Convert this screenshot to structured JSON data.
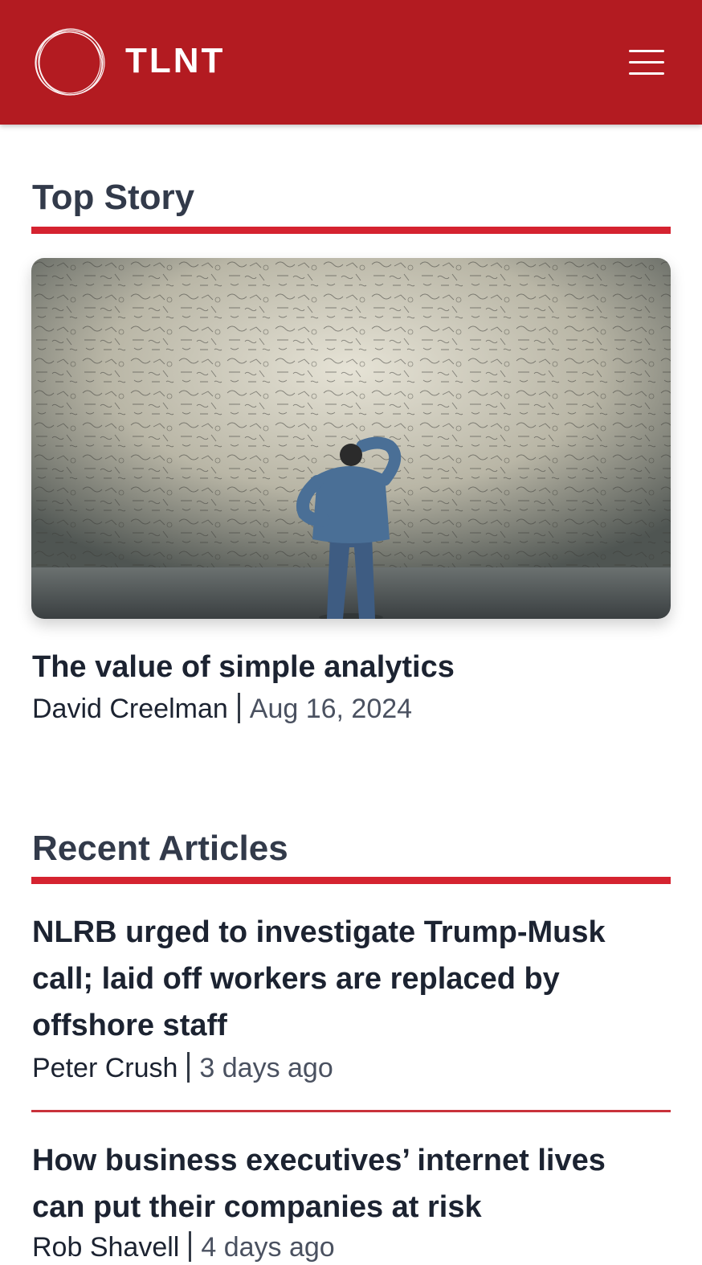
{
  "header": {
    "brand": "TLNT",
    "menu_icon": "hamburger-menu-icon",
    "background_color": "#b31b21"
  },
  "top_story": {
    "heading": "Top Story",
    "image_description_icon": "man-looking-at-wall-of-equations-image",
    "title": "The value of simple analytics",
    "author": "David Creelman",
    "date": "Aug 16, 2024"
  },
  "recent_articles": {
    "heading": "Recent Articles",
    "items": [
      {
        "title_lines": [
          "NLRB urged to investigate Trump-Musk",
          "call; laid off workers are replaced by",
          "offshore staff"
        ],
        "author": "Peter Crush",
        "date": "3 days ago"
      },
      {
        "title_lines": [
          "How business executives’ internet lives",
          "can put their companies at risk"
        ],
        "author": "Rob Shavell",
        "date": "4 days ago"
      }
    ]
  },
  "colors": {
    "accent": "#d52330",
    "heading": "#323a4a",
    "text": "#1c2331"
  }
}
